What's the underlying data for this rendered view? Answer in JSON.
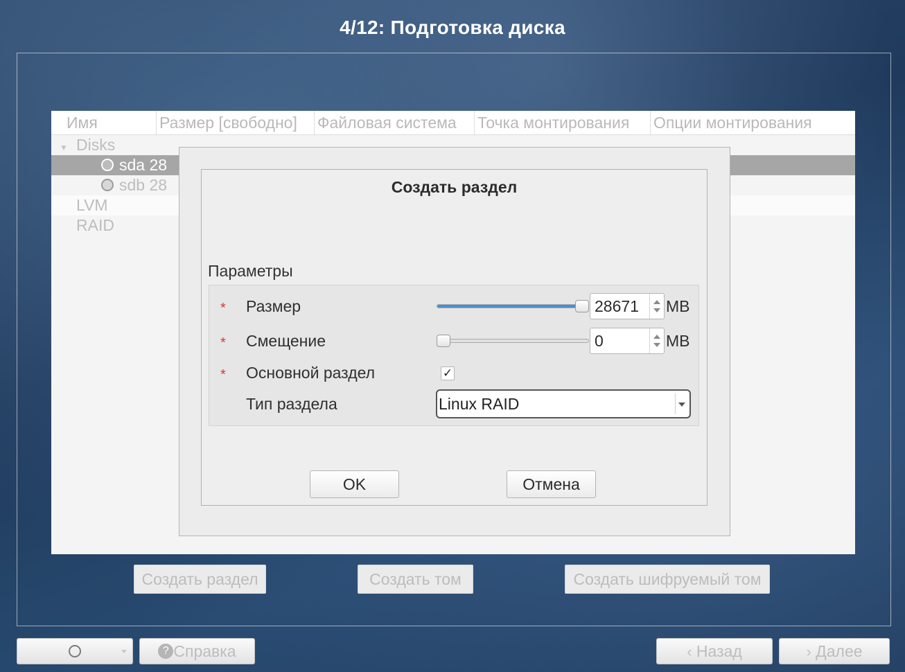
{
  "window": {
    "title": "4/12: Подготовка диска"
  },
  "tree": {
    "columns": [
      "Имя",
      "Размер [свободно]",
      "Файловая система",
      "Точка монтирования",
      "Опции монтирования"
    ],
    "disks_label": "Disks",
    "items": [
      {
        "name": "sda",
        "size_partial": "28",
        "selected": true
      },
      {
        "name": "sdb",
        "size_partial": "28",
        "selected": false
      }
    ],
    "lvm_label": "LVM",
    "raid_label": "RAID"
  },
  "dialog": {
    "title": "Создать раздел",
    "params_label": "Параметры",
    "size": {
      "label": "Размер",
      "value": "28671",
      "unit": "MB",
      "slider_fraction": 1.0
    },
    "offset": {
      "label": "Смещение",
      "value": "0",
      "unit": "MB",
      "slider_fraction": 0.0
    },
    "primary": {
      "label": "Основной раздел",
      "checked": true,
      "check_glyph": "✓"
    },
    "type": {
      "label": "Тип раздела",
      "value": "Linux RAID"
    },
    "required_mark": "*",
    "ok_label": "OK",
    "cancel_label": "Отмена"
  },
  "actions": {
    "create_partition": "Создать раздел",
    "create_volume": "Создать том",
    "create_encrypted": "Создать шифруемый том"
  },
  "bottom": {
    "help_label": "Справка",
    "back_label": "Назад",
    "next_label": "Далее",
    "back_glyph": "‹",
    "next_glyph": "›",
    "help_glyph": "?"
  },
  "colors": {
    "accent": "#4a8fd0",
    "required": "#d93636",
    "selected_row": "#a6a6a6"
  }
}
